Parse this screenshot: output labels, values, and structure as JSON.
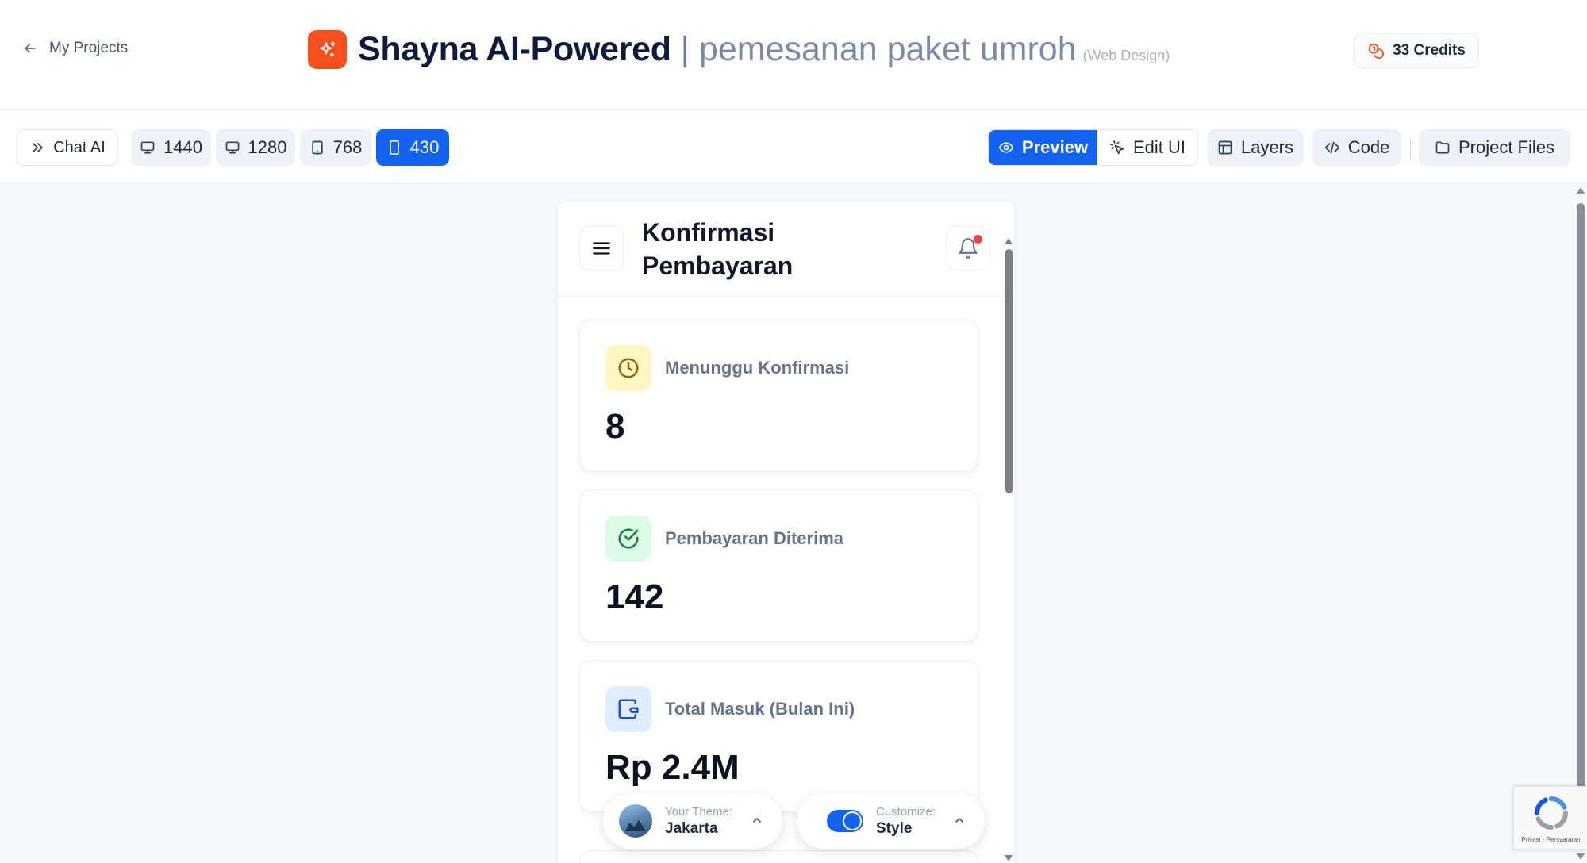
{
  "header": {
    "back_label": "My Projects",
    "app_title": "Shayna AI-Powered",
    "separator": "|",
    "project_name": "pemesanan paket umroh",
    "project_type": "(Web Design)",
    "credits_label": "33 Credits"
  },
  "toolbar": {
    "chat_label": "Chat AI",
    "breakpoints": [
      "1440",
      "1280",
      "768",
      "430"
    ],
    "active_breakpoint": "430",
    "preview_label": "Preview",
    "edit_label": "Edit UI",
    "layers_label": "Layers",
    "code_label": "Code",
    "files_label": "Project Files"
  },
  "device": {
    "page_title": "Konfirmasi Pembayaran",
    "stats": [
      {
        "label": "Menunggu Konfirmasi",
        "value": "8",
        "icon": "clock-icon",
        "color": "#fef7c3"
      },
      {
        "label": "Pembayaran Diterima",
        "value": "142",
        "icon": "check-circle-icon",
        "color": "#dcfce7"
      },
      {
        "label": "Total Masuk (Bulan Ini)",
        "value": "Rp 2.4M",
        "icon": "wallet-icon",
        "color": "#e0ecff"
      }
    ]
  },
  "theme_picker": {
    "caption": "Your Theme:",
    "value": "Jakarta"
  },
  "style_picker": {
    "caption": "Customize:",
    "value": "Style"
  },
  "recaptcha": {
    "text": "Privasi - Persyaratan"
  },
  "colors": {
    "accent": "#1462f0",
    "brand": "#f4511e",
    "notification": "#ef4444"
  }
}
